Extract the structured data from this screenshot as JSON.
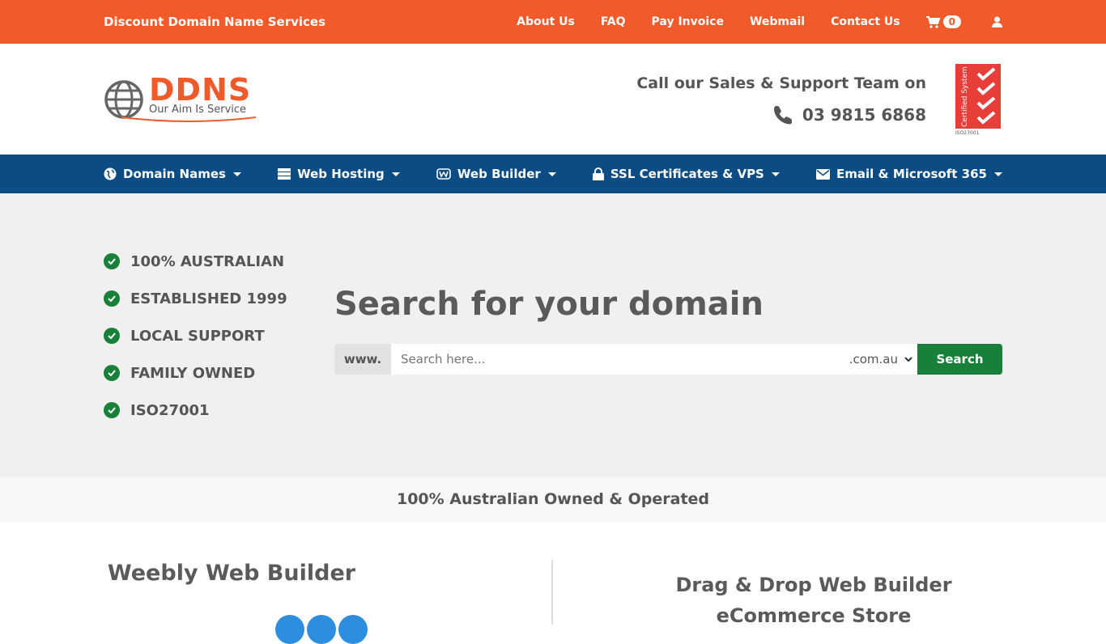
{
  "topbar": {
    "brand": "Discount Domain Name Services",
    "links": [
      "About Us",
      "FAQ",
      "Pay Invoice",
      "Webmail",
      "Contact Us"
    ],
    "cart_count": "0"
  },
  "header": {
    "logo_main": "DDNS",
    "logo_tag": "Our Aim Is Service",
    "sales_title": "Call our Sales & Support Team on",
    "phone": "03 9815 6868",
    "cert_text": "Certified System",
    "cert_code": "ISO27001"
  },
  "nav": {
    "items": [
      "Domain Names",
      "Web Hosting",
      "Web Builder",
      "SSL Certificates & VPS",
      "Email & Microsoft 365"
    ]
  },
  "hero": {
    "features": [
      "100% AUSTRALIAN",
      "ESTABLISHED 1999",
      "LOCAL SUPPORT",
      "FAMILY OWNED",
      "ISO27001"
    ],
    "title": "Search for your domain",
    "prefix": "www.",
    "placeholder": "Search here...",
    "tld": ".com.au",
    "button": "Search"
  },
  "band": {
    "text": "100% Australian Owned & Operated"
  },
  "bottom": {
    "left_title": "Weebly Web Builder",
    "right_title": "Drag & Drop Web Builder",
    "right_sub": "eCommerce Store"
  },
  "colors": {
    "orange": "#f15a2b",
    "navy": "#0b4c85",
    "green": "#188038"
  }
}
